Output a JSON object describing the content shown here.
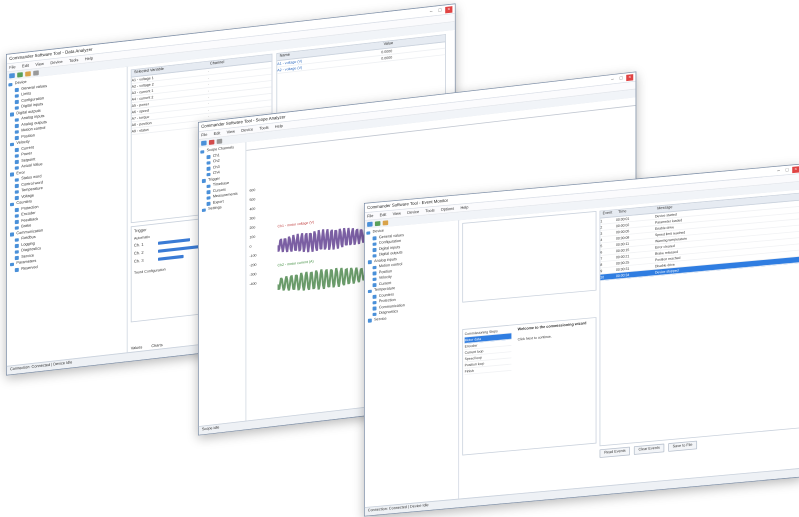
{
  "window1": {
    "title": "Commander Software Tool - Data Analyzer",
    "menu": [
      "File",
      "Edit",
      "View",
      "Device",
      "Tools",
      "Help"
    ],
    "status": "Connection: Connected | Device Idle",
    "left_tabs": [
      "Values",
      "Charts"
    ],
    "tree": [
      "Device",
      "General values",
      "Limits",
      "Configuration",
      "Digital inputs",
      "Digital outputs",
      "Analog inputs",
      "Analog outputs",
      "Motion control",
      "Position",
      "Velocity",
      "Current",
      "Power",
      "Setpoint",
      "Actual Value",
      "Error",
      "Status word",
      "Control word",
      "Temperature",
      "Voltage",
      "Counters",
      "Protection",
      "Encoder",
      "Feedback",
      "Brake",
      "Communication",
      "Fieldbus",
      "Logging",
      "Diagnostics",
      "Service",
      "Parameters",
      "Reserved"
    ],
    "signals_header": [
      "Selected Variable",
      "Channel"
    ],
    "signals": [
      "A1 - voltage 1",
      "A2 - voltage 2",
      "A3 - current 1",
      "A4 - current 2",
      "A5 - power",
      "A6 - speed",
      "A7 - torque",
      "A8 - position",
      "A9 - status"
    ],
    "right_header": [
      "Name",
      "Value"
    ],
    "right_rows": [
      [
        "A1 - voltage (V)",
        "0.0000"
      ],
      [
        "A2 - voltage (V)",
        "0.0000"
      ]
    ],
    "trigger_label": "Trigger",
    "trigger_mode": "Automatic",
    "bars": [
      "Ch. 1",
      "Ch. 2",
      "Ch. 3"
    ],
    "tab_configuration": "Trend Configuration"
  },
  "window2": {
    "title": "Commander Software Tool - Scope Analyzer",
    "menu": [
      "File",
      "Edit",
      "View",
      "Device",
      "Tools",
      "Help"
    ],
    "y_axis_ticks": [
      "600",
      "500",
      "400",
      "300",
      "200",
      "100",
      "0",
      "-100",
      "-200",
      "-300",
      "-400"
    ],
    "trace1_label": "Ch1 - motor voltage (V)",
    "trace2_label": "Ch2 - motor current (A)",
    "tree": [
      "Scope Channels",
      "Ch1",
      "Ch2",
      "Ch3",
      "Ch4",
      "Trigger",
      "Timebase",
      "Cursors",
      "Measurements",
      "Export",
      "Settings"
    ],
    "status": "Scope idle"
  },
  "window3": {
    "title": "Commander Software Tool - Event Monitor",
    "menu": [
      "File",
      "Edit",
      "View",
      "Device",
      "Tools",
      "Options",
      "Help"
    ],
    "tree": [
      "Device",
      "General values",
      "Configuration",
      "Digital inputs",
      "Digital outputs",
      "Analog inputs",
      "Motion control",
      "Position",
      "Velocity",
      "Current",
      "Temperature",
      "Counters",
      "Protection",
      "Communication",
      "Diagnostics",
      "Service"
    ],
    "wizard_title": "Welcome to the commissioning wizard",
    "wizard_text": "Click Next to continue.",
    "steps": [
      "Commissioning Steps",
      "Motor data",
      "Encoder",
      "Current loop",
      "Speed loop",
      "Position loop",
      "Finish"
    ],
    "events_header": [
      "Event",
      "Time",
      "Message"
    ],
    "events": [
      [
        "1",
        "00:00:01",
        "Device started"
      ],
      [
        "2",
        "00:00:02",
        "Parameter loaded"
      ],
      [
        "3",
        "00:00:05",
        "Enable drive"
      ],
      [
        "4",
        "00:00:08",
        "Speed limit reached"
      ],
      [
        "5",
        "00:00:11",
        "Warning temperature"
      ],
      [
        "6",
        "00:00:15",
        "Error cleared"
      ],
      [
        "7",
        "00:00:21",
        "Brake released"
      ],
      [
        "8",
        "00:00:25",
        "Position reached"
      ],
      [
        "9",
        "00:00:31",
        "Disable drive"
      ],
      [
        "10",
        "00:00:34",
        "Device stopped"
      ]
    ],
    "selected_event": "10",
    "buttons": [
      "Read Events",
      "Clear Events",
      "Save to File"
    ],
    "status": "Connection: Connected | Device Idle"
  }
}
